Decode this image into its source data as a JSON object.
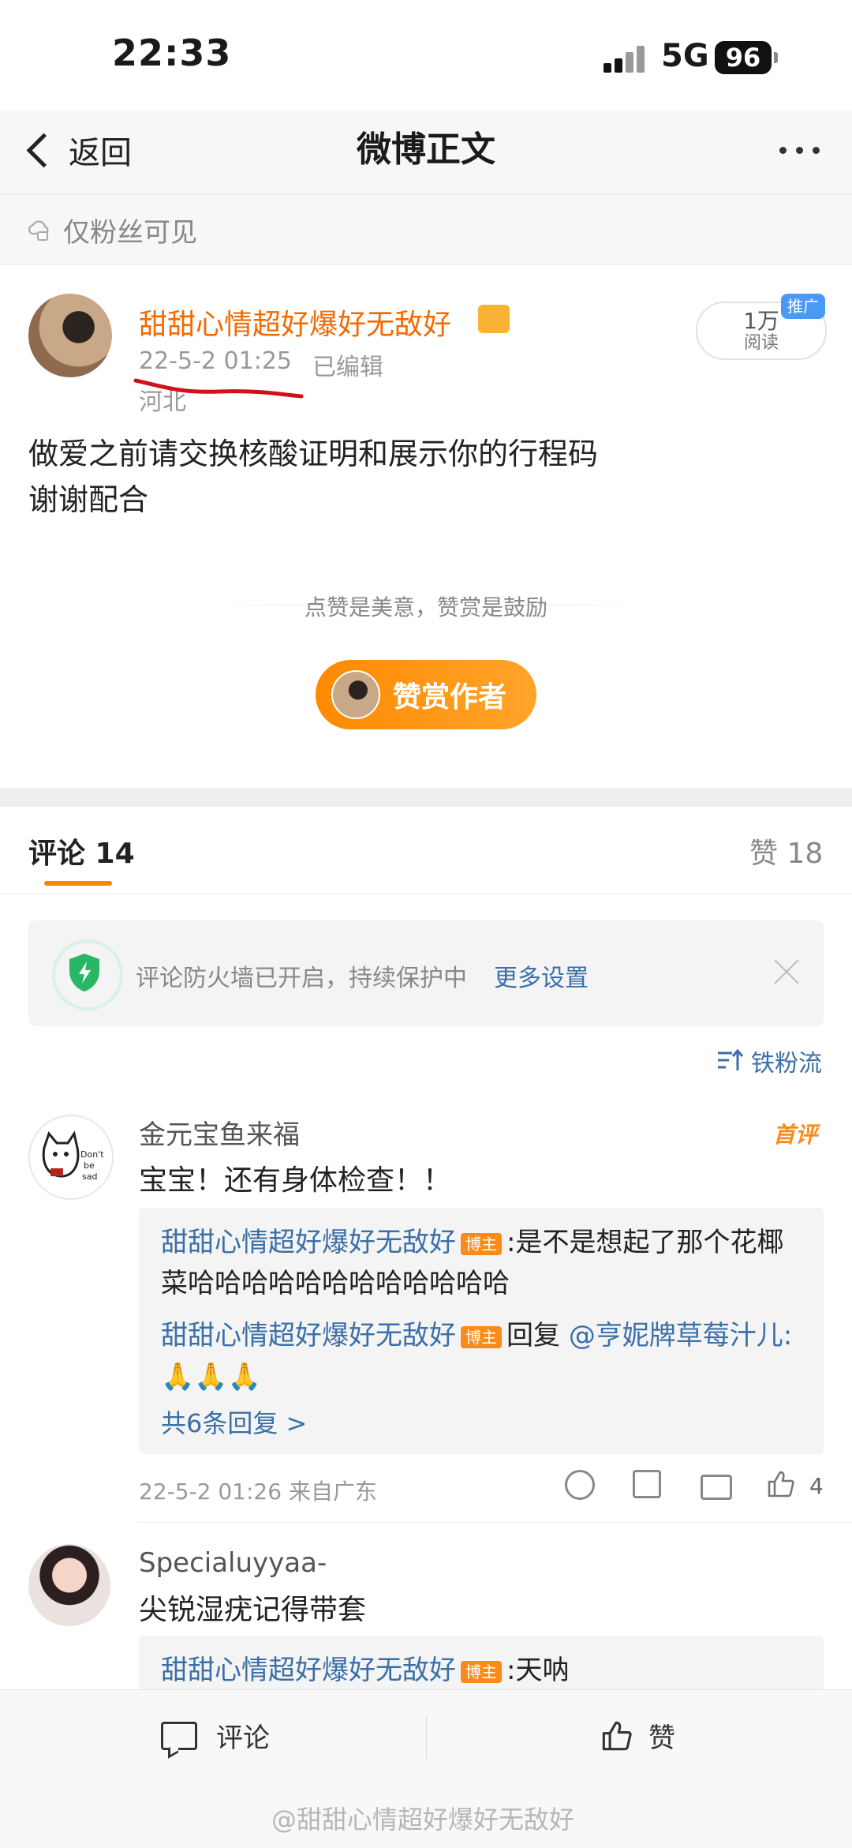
{
  "status_bar": {
    "time": "22:33",
    "network": "5G",
    "battery": "96"
  },
  "nav": {
    "back_label": "返回",
    "title": "微博正文"
  },
  "visibility": {
    "label": "仅粉丝可见"
  },
  "post": {
    "author": "甜甜心情超好爆好无敌好",
    "time": "22-5-2 01:25",
    "edited": "已编辑",
    "location": "河北",
    "reads": "1万",
    "reads_label": "阅读",
    "promo_badge": "推广",
    "body": "做爱之前请交换核酸证明和展示你的行程码\n谢谢配合"
  },
  "reward": {
    "hint": "点赞是美意，赞赏是鼓励",
    "button": "赞赏作者"
  },
  "tabs": {
    "comments": "评论 14",
    "likes": "赞 18"
  },
  "firewall": {
    "text": "评论防火墙已开启，持续保护中",
    "link": "更多设置"
  },
  "sort": {
    "label": "铁粉流"
  },
  "comments": [
    {
      "name": "金元宝鱼来福",
      "badge": "首评",
      "text": "宝宝！还有身体检查！！",
      "replies": [
        {
          "name": "甜甜心情超好爆好无敌好",
          "tag": "博主",
          "text": ":是不是想起了那个花椰菜哈哈哈哈哈哈哈哈哈哈哈哈"
        },
        {
          "name": "甜甜心情超好爆好无敌好",
          "tag": "博主",
          "text": "回复",
          "mention": "@亨妮牌草莓汁儿:",
          "emoji": "🙏🙏🙏"
        }
      ],
      "more_replies": "共6条回复 >",
      "meta": "22-5-2 01:26 来自广东",
      "likes": "4"
    },
    {
      "name": "Specialuyyaa-",
      "text": "尖锐湿疣记得带套",
      "replies": [
        {
          "name": "甜甜心情超好爆好无敌好",
          "tag": "博主",
          "text": ":天呐"
        }
      ]
    }
  ],
  "bottom_bar": {
    "comment": "评论",
    "like": "赞"
  },
  "watermark": "@甜甜心情超好爆好无敌好",
  "colors": {
    "accent": "#ff8200",
    "link": "#3a6fa8",
    "author": "#f26a00",
    "shield": "#29b765"
  }
}
